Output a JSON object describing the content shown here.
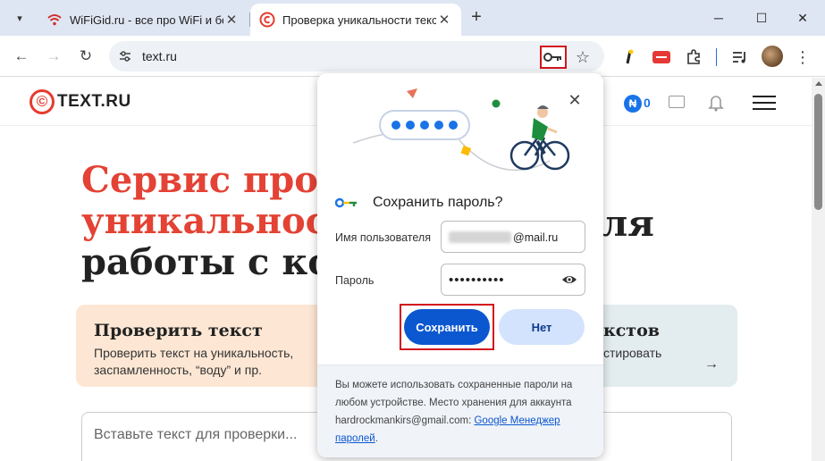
{
  "browser": {
    "tabs": [
      {
        "title": "WiFiGid.ru - все про WiFi и бес",
        "active": false
      },
      {
        "title": "Проверка уникальности текста",
        "active": true
      }
    ],
    "new_tab_symbol": "+",
    "url": "text.ru",
    "accent_color": "#0b57d0",
    "highlight_color": "#d3141c"
  },
  "site": {
    "logo_text": "TEXT.RU",
    "logo_mark": "©",
    "coin_symbol": "₦",
    "coin_count": "0",
    "hero": {
      "line1": "Сервис прове",
      "line2": "уникальност",
      "line3": "работы с кон",
      "tail": "ля"
    },
    "card_check": {
      "title": "Проверить текст",
      "desc": "Проверить текст на уникальность, заспамленность, “воду” и пр."
    },
    "card_rewrite": {
      "title": "кстов",
      "desc": "стировать",
      "arrow": "→"
    },
    "textarea_placeholder": "Вставьте текст для проверки..."
  },
  "password_bubble": {
    "title": "Сохранить пароль?",
    "username_label": "Имя пользователя",
    "username_value": "@mail.ru",
    "password_label": "Пароль",
    "password_value": "••••••••••",
    "save_label": "Сохранить",
    "no_label": "Нет",
    "close_symbol": "✕",
    "footer_text": "Вы можете использовать сохраненные пароли на любом устройстве. Место хранения для аккаунта hardrockmankirs@gmail.com:",
    "footer_link": "Google Менеджер паролей",
    "footer_end": "."
  }
}
